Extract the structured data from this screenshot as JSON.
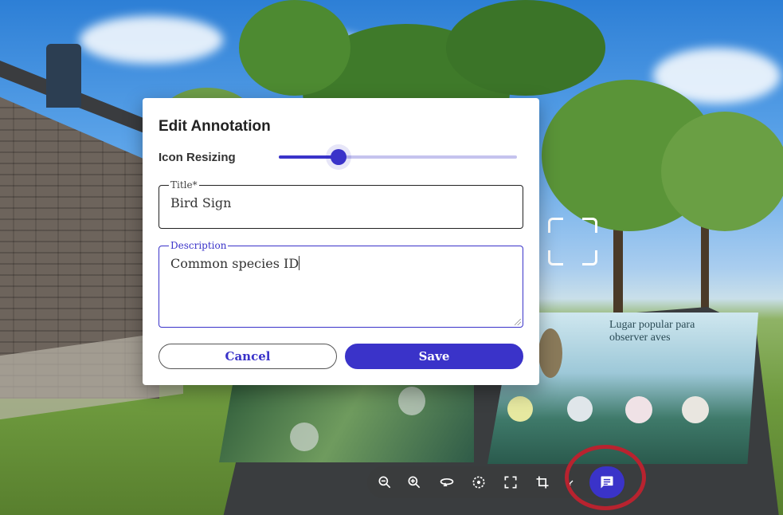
{
  "dialog": {
    "title": "Edit Annotation",
    "icon_resizing_label": "Icon Resizing",
    "icon_resizing_value": 0.25,
    "title_field": {
      "label": "Title*",
      "value": "Bird Sign"
    },
    "description_field": {
      "label": "Description",
      "value": "Common species ID"
    },
    "cancel_label": "Cancel",
    "save_label": "Save"
  },
  "sign": {
    "heading": "Lugar popular para observer aves"
  },
  "toolbar": {
    "tools": [
      "zoom-out-icon",
      "zoom-in-icon",
      "rotate-360-icon",
      "reset-view-icon",
      "fullscreen-icon",
      "crop-icon",
      "annotation-icon"
    ]
  },
  "colors": {
    "accent": "#3a33c9",
    "highlight": "#b8232f"
  }
}
